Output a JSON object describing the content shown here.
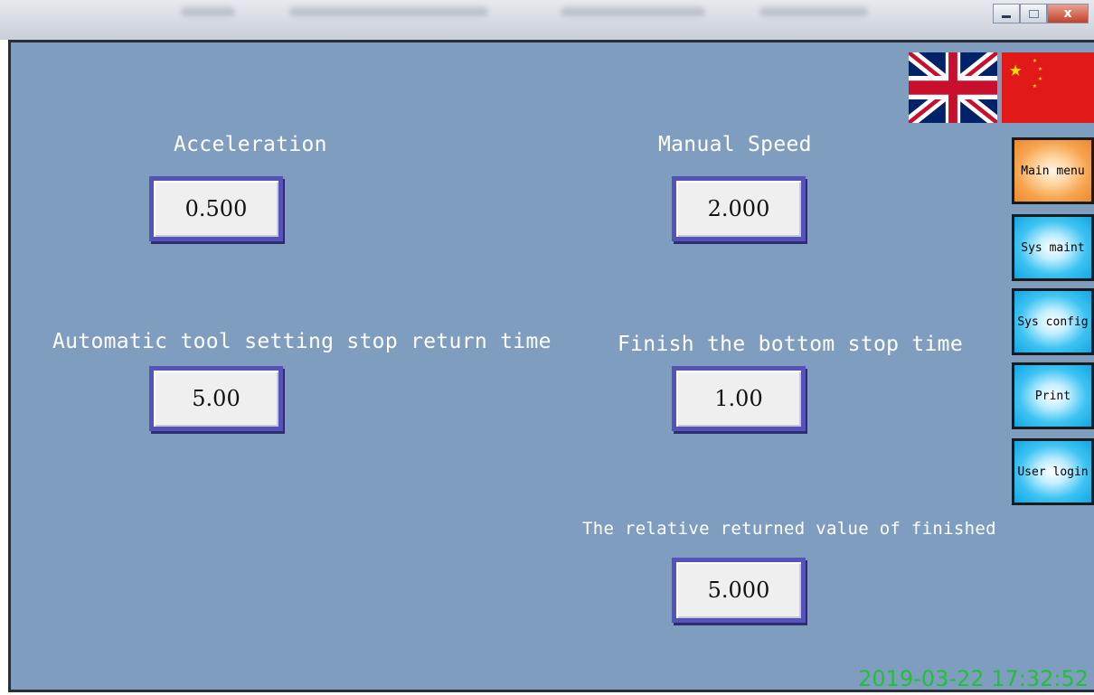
{
  "flags": {
    "english": "english-flag",
    "chinese": "chinese-flag"
  },
  "fields": {
    "acceleration": {
      "label": "Acceleration",
      "value": "0.500"
    },
    "manual_speed": {
      "label": "Manual Speed",
      "value": "2.000"
    },
    "auto_tool_return": {
      "label": "Automatic tool setting stop return time",
      "value": "5.00"
    },
    "finish_bottom_stop": {
      "label": "Finish the bottom stop time",
      "value": "1.00"
    },
    "relative_returned": {
      "label": "The relative returned value of finished",
      "value": "5.000"
    }
  },
  "nav": {
    "main_menu": "Main menu",
    "sys_maint": "Sys maint",
    "sys_config": "Sys config",
    "print": "Print",
    "user_login": "User login"
  },
  "status": {
    "timestamp": "2019-03-22 17:32:52"
  },
  "colors": {
    "panel_bg": "#7f9ebf",
    "box_border": "#5552b9",
    "active_tab": "#f6a44f",
    "tab": "#3dc3f2",
    "timestamp": "#22c03a"
  }
}
